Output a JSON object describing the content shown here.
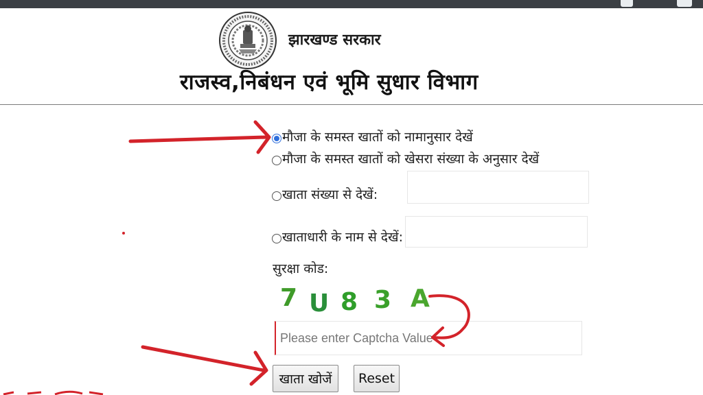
{
  "header": {
    "gov_name": "झारखण्ड सरकार",
    "dept_name": "राजस्व,निबंधन एवं भूमि सुधार विभाग",
    "emblem_icon": "jharkhand-emblem-icon"
  },
  "form": {
    "options": [
      {
        "label": "मौजा के समस्त खातों को नामानुसार देखें",
        "checked": true
      },
      {
        "label": "मौजा के समस्त खातों को खेसरा संख्या के अनुसार देखें",
        "checked": false
      },
      {
        "label": "खाता संख्या से देखें:",
        "checked": false
      },
      {
        "label": "खाताधारी के नाम से देखें:",
        "checked": false
      }
    ],
    "khata_input_value": "",
    "name_input_value": "",
    "captcha_label": "सुरक्षा कोड:",
    "captcha_chars": [
      "7",
      "U",
      "8",
      "3",
      "A"
    ],
    "captcha_colors": [
      "#3f9b2a",
      "#2a8f3a",
      "#2f9e2a",
      "#3aa02a",
      "#4aa62e"
    ],
    "captcha_placeholder": "Please enter Captcha Value",
    "captcha_value": "",
    "search_button": "खाता खोजें",
    "reset_button": "Reset"
  },
  "annotations": {
    "arrow_color": "#d3232a"
  }
}
